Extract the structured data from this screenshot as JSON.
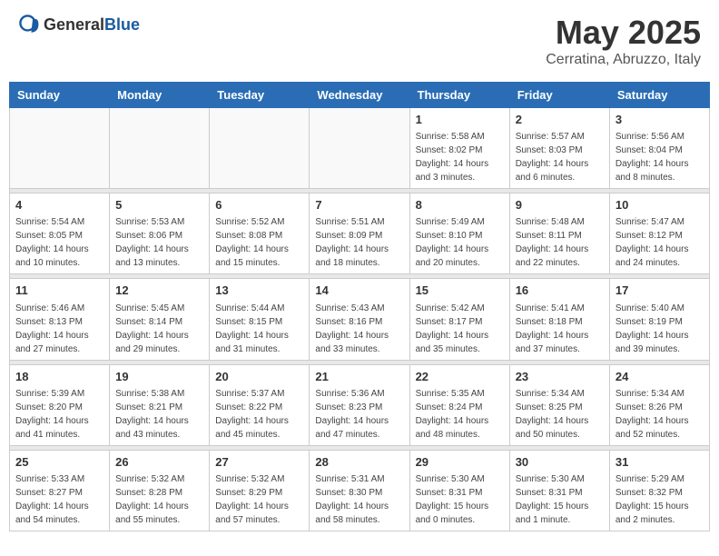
{
  "header": {
    "logo_general": "General",
    "logo_blue": "Blue",
    "month_title": "May 2025",
    "location": "Cerratina, Abruzzo, Italy"
  },
  "weekdays": [
    "Sunday",
    "Monday",
    "Tuesday",
    "Wednesday",
    "Thursday",
    "Friday",
    "Saturday"
  ],
  "weeks": [
    [
      {
        "day": "",
        "info": ""
      },
      {
        "day": "",
        "info": ""
      },
      {
        "day": "",
        "info": ""
      },
      {
        "day": "",
        "info": ""
      },
      {
        "day": "1",
        "info": "Sunrise: 5:58 AM\nSunset: 8:02 PM\nDaylight: 14 hours\nand 3 minutes."
      },
      {
        "day": "2",
        "info": "Sunrise: 5:57 AM\nSunset: 8:03 PM\nDaylight: 14 hours\nand 6 minutes."
      },
      {
        "day": "3",
        "info": "Sunrise: 5:56 AM\nSunset: 8:04 PM\nDaylight: 14 hours\nand 8 minutes."
      }
    ],
    [
      {
        "day": "4",
        "info": "Sunrise: 5:54 AM\nSunset: 8:05 PM\nDaylight: 14 hours\nand 10 minutes."
      },
      {
        "day": "5",
        "info": "Sunrise: 5:53 AM\nSunset: 8:06 PM\nDaylight: 14 hours\nand 13 minutes."
      },
      {
        "day": "6",
        "info": "Sunrise: 5:52 AM\nSunset: 8:08 PM\nDaylight: 14 hours\nand 15 minutes."
      },
      {
        "day": "7",
        "info": "Sunrise: 5:51 AM\nSunset: 8:09 PM\nDaylight: 14 hours\nand 18 minutes."
      },
      {
        "day": "8",
        "info": "Sunrise: 5:49 AM\nSunset: 8:10 PM\nDaylight: 14 hours\nand 20 minutes."
      },
      {
        "day": "9",
        "info": "Sunrise: 5:48 AM\nSunset: 8:11 PM\nDaylight: 14 hours\nand 22 minutes."
      },
      {
        "day": "10",
        "info": "Sunrise: 5:47 AM\nSunset: 8:12 PM\nDaylight: 14 hours\nand 24 minutes."
      }
    ],
    [
      {
        "day": "11",
        "info": "Sunrise: 5:46 AM\nSunset: 8:13 PM\nDaylight: 14 hours\nand 27 minutes."
      },
      {
        "day": "12",
        "info": "Sunrise: 5:45 AM\nSunset: 8:14 PM\nDaylight: 14 hours\nand 29 minutes."
      },
      {
        "day": "13",
        "info": "Sunrise: 5:44 AM\nSunset: 8:15 PM\nDaylight: 14 hours\nand 31 minutes."
      },
      {
        "day": "14",
        "info": "Sunrise: 5:43 AM\nSunset: 8:16 PM\nDaylight: 14 hours\nand 33 minutes."
      },
      {
        "day": "15",
        "info": "Sunrise: 5:42 AM\nSunset: 8:17 PM\nDaylight: 14 hours\nand 35 minutes."
      },
      {
        "day": "16",
        "info": "Sunrise: 5:41 AM\nSunset: 8:18 PM\nDaylight: 14 hours\nand 37 minutes."
      },
      {
        "day": "17",
        "info": "Sunrise: 5:40 AM\nSunset: 8:19 PM\nDaylight: 14 hours\nand 39 minutes."
      }
    ],
    [
      {
        "day": "18",
        "info": "Sunrise: 5:39 AM\nSunset: 8:20 PM\nDaylight: 14 hours\nand 41 minutes."
      },
      {
        "day": "19",
        "info": "Sunrise: 5:38 AM\nSunset: 8:21 PM\nDaylight: 14 hours\nand 43 minutes."
      },
      {
        "day": "20",
        "info": "Sunrise: 5:37 AM\nSunset: 8:22 PM\nDaylight: 14 hours\nand 45 minutes."
      },
      {
        "day": "21",
        "info": "Sunrise: 5:36 AM\nSunset: 8:23 PM\nDaylight: 14 hours\nand 47 minutes."
      },
      {
        "day": "22",
        "info": "Sunrise: 5:35 AM\nSunset: 8:24 PM\nDaylight: 14 hours\nand 48 minutes."
      },
      {
        "day": "23",
        "info": "Sunrise: 5:34 AM\nSunset: 8:25 PM\nDaylight: 14 hours\nand 50 minutes."
      },
      {
        "day": "24",
        "info": "Sunrise: 5:34 AM\nSunset: 8:26 PM\nDaylight: 14 hours\nand 52 minutes."
      }
    ],
    [
      {
        "day": "25",
        "info": "Sunrise: 5:33 AM\nSunset: 8:27 PM\nDaylight: 14 hours\nand 54 minutes."
      },
      {
        "day": "26",
        "info": "Sunrise: 5:32 AM\nSunset: 8:28 PM\nDaylight: 14 hours\nand 55 minutes."
      },
      {
        "day": "27",
        "info": "Sunrise: 5:32 AM\nSunset: 8:29 PM\nDaylight: 14 hours\nand 57 minutes."
      },
      {
        "day": "28",
        "info": "Sunrise: 5:31 AM\nSunset: 8:30 PM\nDaylight: 14 hours\nand 58 minutes."
      },
      {
        "day": "29",
        "info": "Sunrise: 5:30 AM\nSunset: 8:31 PM\nDaylight: 15 hours\nand 0 minutes."
      },
      {
        "day": "30",
        "info": "Sunrise: 5:30 AM\nSunset: 8:31 PM\nDaylight: 15 hours\nand 1 minute."
      },
      {
        "day": "31",
        "info": "Sunrise: 5:29 AM\nSunset: 8:32 PM\nDaylight: 15 hours\nand 2 minutes."
      }
    ]
  ]
}
